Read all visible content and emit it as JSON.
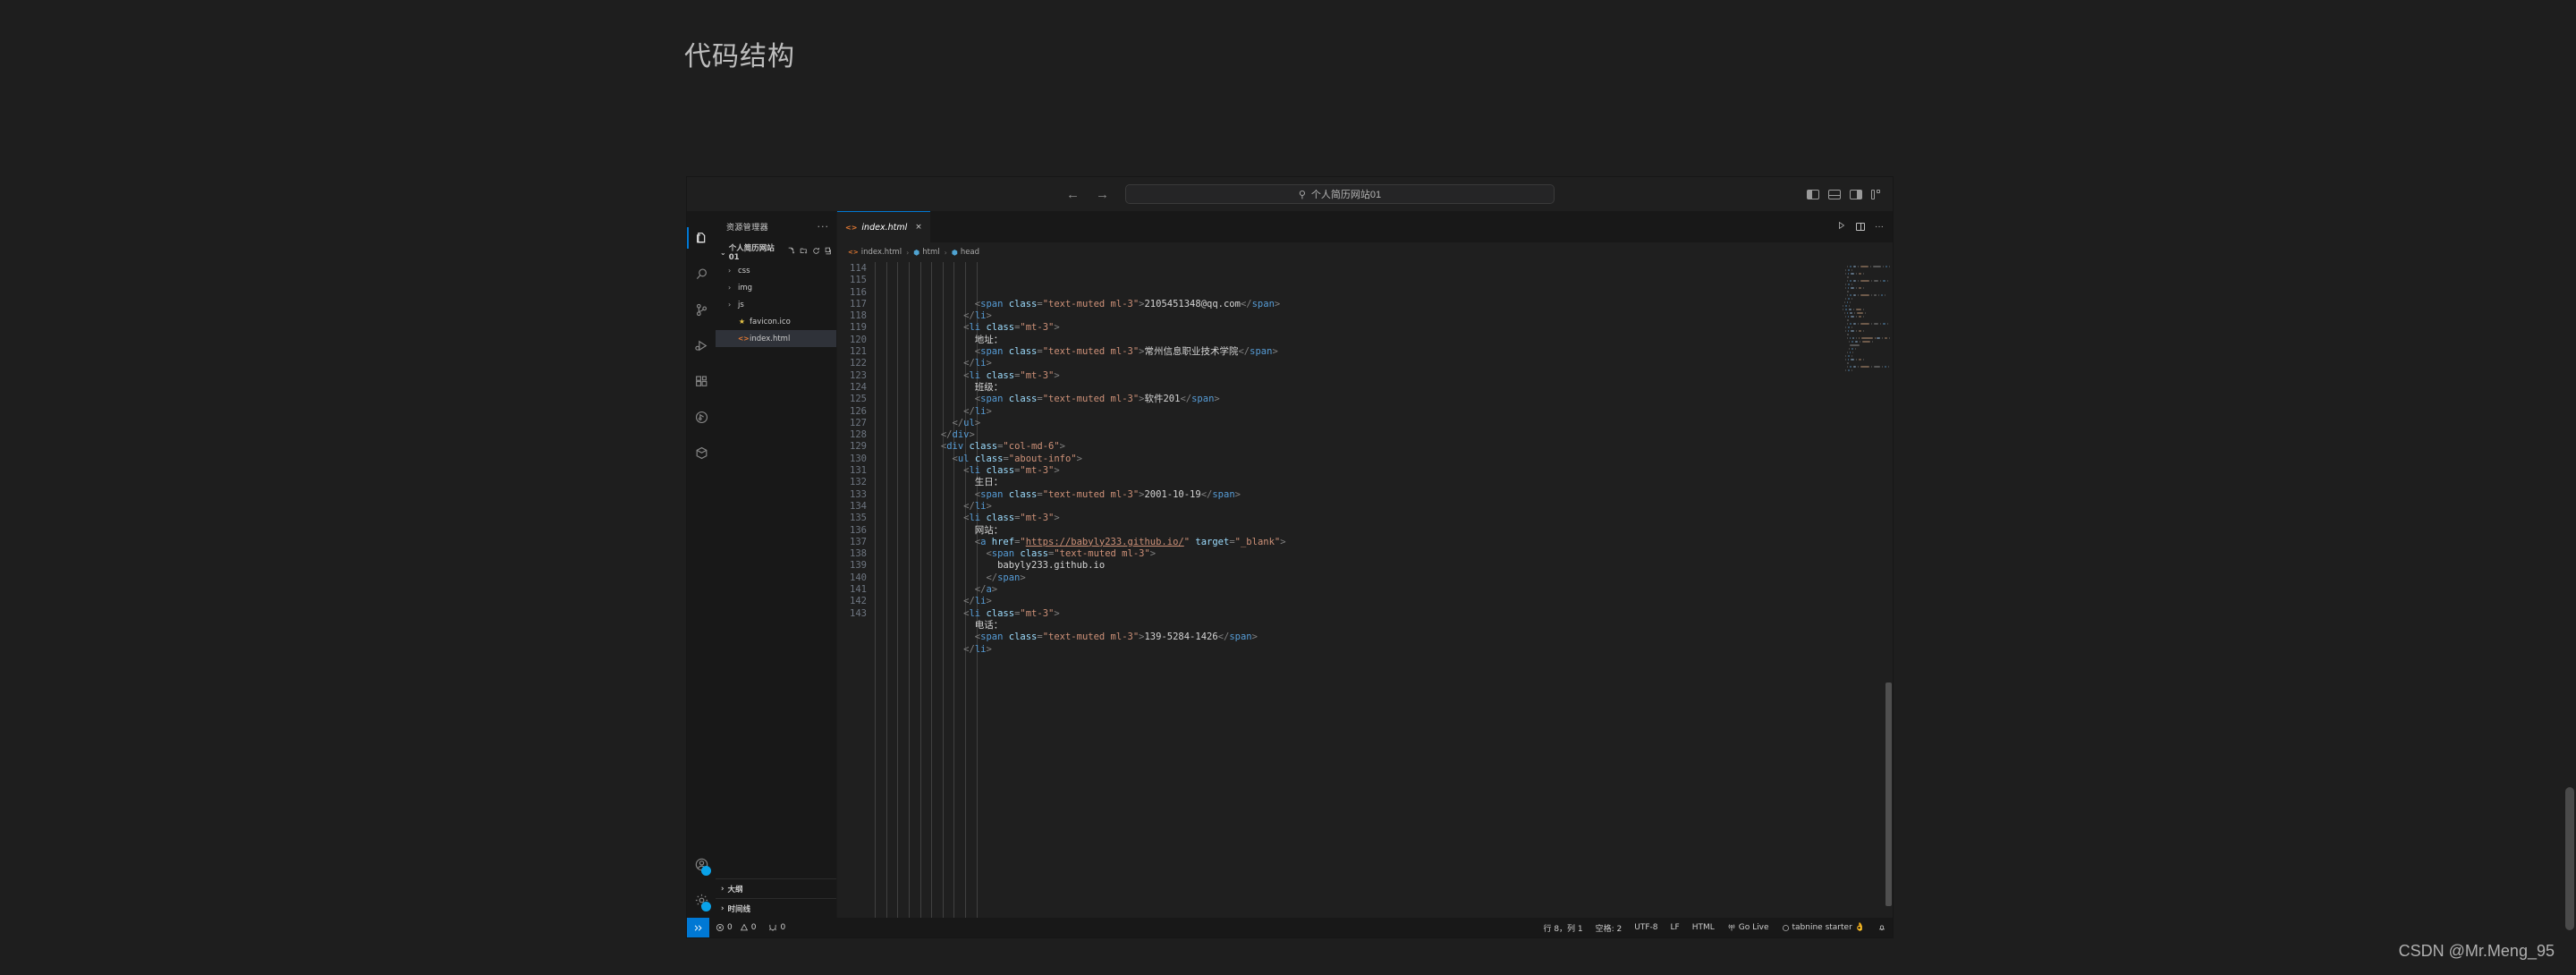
{
  "page": {
    "title": "代码结构",
    "watermark": "CSDN @Mr.Meng_95",
    "background_color": "#1e1e1e"
  },
  "titlebar": {
    "back_icon": "←",
    "forward_icon": "→",
    "search_icon": "search-icon",
    "search_value": "个人简历网站01",
    "layout_buttons": [
      "toggle-primary-sidebar",
      "toggle-panel",
      "toggle-secondary-sidebar",
      "customize-layout"
    ]
  },
  "activitybar": {
    "items": [
      {
        "name": "explorer",
        "glyph": "files-icon",
        "active": true
      },
      {
        "name": "search",
        "glyph": "search-icon",
        "active": false
      },
      {
        "name": "source-control",
        "glyph": "source-control-icon",
        "active": false
      },
      {
        "name": "run-and-debug",
        "glyph": "debug-icon",
        "active": false
      },
      {
        "name": "extensions",
        "glyph": "extensions-icon",
        "active": false
      },
      {
        "name": "testing",
        "glyph": "beaker-icon",
        "active": false
      },
      {
        "name": "remote",
        "glyph": "cube-icon",
        "active": false
      }
    ],
    "bottom_items": [
      {
        "name": "accounts",
        "glyph": "account-icon"
      },
      {
        "name": "settings",
        "glyph": "gear-icon"
      }
    ]
  },
  "sidebar": {
    "header": "资源管理器",
    "more_actions": "···",
    "root": {
      "label": "个人简历网站01",
      "chevron": "⌄",
      "actions": [
        "new-file",
        "new-folder",
        "refresh",
        "collapse-all"
      ]
    },
    "tree": [
      {
        "label": "css",
        "type": "folder",
        "chevron": "›",
        "icon": "folder-icon",
        "selected": false
      },
      {
        "label": "img",
        "type": "folder",
        "chevron": "›",
        "icon": "folder-icon",
        "selected": false
      },
      {
        "label": "js",
        "type": "folder",
        "chevron": "›",
        "icon": "folder-icon",
        "selected": false
      },
      {
        "label": "favicon.ico",
        "type": "file",
        "chevron": "",
        "icon": "star-icon",
        "selected": false
      },
      {
        "label": "index.html",
        "type": "file",
        "chevron": "",
        "icon": "html-file-icon",
        "selected": true
      }
    ],
    "sections": [
      {
        "label": "大纲",
        "chevron": "›"
      },
      {
        "label": "时间线",
        "chevron": "›"
      }
    ]
  },
  "editor": {
    "tab": {
      "label": "index.html",
      "icon": "html-file-icon",
      "close_icon": "×"
    },
    "tab_actions": [
      "run-icon",
      "split-editor-icon",
      "more-actions-icon"
    ],
    "breadcrumbs": [
      {
        "label": "index.html",
        "icon": "html-file-icon"
      },
      {
        "label": "html",
        "icon": "symbol-cube-icon"
      },
      {
        "label": "head",
        "icon": "symbol-cube-icon"
      }
    ],
    "first_line_number": 114,
    "lines": [
      {
        "n": 114,
        "indent": 5,
        "tokens": [
          {
            "t": "brk",
            "v": "<"
          },
          {
            "t": "tag",
            "v": "span"
          },
          {
            "t": "attr",
            "v": " class"
          },
          {
            "t": "brk",
            "v": "="
          },
          {
            "t": "str",
            "v": "\"text-muted ml-3\""
          },
          {
            "t": "brk",
            "v": ">"
          },
          {
            "t": "txt",
            "v": "2105451348@qq.com"
          },
          {
            "t": "brk",
            "v": "</"
          },
          {
            "t": "tag",
            "v": "span"
          },
          {
            "t": "brk",
            "v": ">"
          }
        ]
      },
      {
        "n": 115,
        "indent": 4,
        "tokens": [
          {
            "t": "brk",
            "v": "</"
          },
          {
            "t": "tag",
            "v": "li"
          },
          {
            "t": "brk",
            "v": ">"
          }
        ]
      },
      {
        "n": 116,
        "indent": 4,
        "tokens": [
          {
            "t": "brk",
            "v": "<"
          },
          {
            "t": "tag",
            "v": "li"
          },
          {
            "t": "attr",
            "v": " class"
          },
          {
            "t": "brk",
            "v": "="
          },
          {
            "t": "str",
            "v": "\"mt-3\""
          },
          {
            "t": "brk",
            "v": ">"
          }
        ]
      },
      {
        "n": 117,
        "indent": 5,
        "tokens": [
          {
            "t": "txt",
            "v": "地址："
          }
        ]
      },
      {
        "n": 118,
        "indent": 5,
        "tokens": [
          {
            "t": "brk",
            "v": "<"
          },
          {
            "t": "tag",
            "v": "span"
          },
          {
            "t": "attr",
            "v": " class"
          },
          {
            "t": "brk",
            "v": "="
          },
          {
            "t": "str",
            "v": "\"text-muted ml-3\""
          },
          {
            "t": "brk",
            "v": ">"
          },
          {
            "t": "txt",
            "v": "常州信息职业技术学院"
          },
          {
            "t": "brk",
            "v": "</"
          },
          {
            "t": "tag",
            "v": "span"
          },
          {
            "t": "brk",
            "v": ">"
          }
        ]
      },
      {
        "n": 119,
        "indent": 4,
        "tokens": [
          {
            "t": "brk",
            "v": "</"
          },
          {
            "t": "tag",
            "v": "li"
          },
          {
            "t": "brk",
            "v": ">"
          }
        ]
      },
      {
        "n": 120,
        "indent": 4,
        "tokens": [
          {
            "t": "brk",
            "v": "<"
          },
          {
            "t": "tag",
            "v": "li"
          },
          {
            "t": "attr",
            "v": " class"
          },
          {
            "t": "brk",
            "v": "="
          },
          {
            "t": "str",
            "v": "\"mt-3\""
          },
          {
            "t": "brk",
            "v": ">"
          }
        ]
      },
      {
        "n": 121,
        "indent": 5,
        "tokens": [
          {
            "t": "txt",
            "v": "班级："
          }
        ]
      },
      {
        "n": 122,
        "indent": 5,
        "tokens": [
          {
            "t": "brk",
            "v": "<"
          },
          {
            "t": "tag",
            "v": "span"
          },
          {
            "t": "attr",
            "v": " class"
          },
          {
            "t": "brk",
            "v": "="
          },
          {
            "t": "str",
            "v": "\"text-muted ml-3\""
          },
          {
            "t": "brk",
            "v": ">"
          },
          {
            "t": "txt",
            "v": "软件201"
          },
          {
            "t": "brk",
            "v": "</"
          },
          {
            "t": "tag",
            "v": "span"
          },
          {
            "t": "brk",
            "v": ">"
          }
        ]
      },
      {
        "n": 123,
        "indent": 4,
        "tokens": [
          {
            "t": "brk",
            "v": "</"
          },
          {
            "t": "tag",
            "v": "li"
          },
          {
            "t": "brk",
            "v": ">"
          }
        ]
      },
      {
        "n": 124,
        "indent": 3,
        "tokens": [
          {
            "t": "brk",
            "v": "</"
          },
          {
            "t": "tag",
            "v": "ul"
          },
          {
            "t": "brk",
            "v": ">"
          }
        ]
      },
      {
        "n": 125,
        "indent": 2,
        "tokens": [
          {
            "t": "brk",
            "v": "</"
          },
          {
            "t": "tag",
            "v": "div"
          },
          {
            "t": "brk",
            "v": ">"
          }
        ]
      },
      {
        "n": 126,
        "indent": 2,
        "tokens": [
          {
            "t": "brk",
            "v": "<"
          },
          {
            "t": "tag",
            "v": "div"
          },
          {
            "t": "attr",
            "v": " class"
          },
          {
            "t": "brk",
            "v": "="
          },
          {
            "t": "str",
            "v": "\"col-md-6\""
          },
          {
            "t": "brk",
            "v": ">"
          }
        ]
      },
      {
        "n": 127,
        "indent": 3,
        "tokens": [
          {
            "t": "brk",
            "v": "<"
          },
          {
            "t": "tag",
            "v": "ul"
          },
          {
            "t": "attr",
            "v": " class"
          },
          {
            "t": "brk",
            "v": "="
          },
          {
            "t": "str",
            "v": "\"about-info\""
          },
          {
            "t": "brk",
            "v": ">"
          }
        ]
      },
      {
        "n": 128,
        "indent": 4,
        "tokens": [
          {
            "t": "brk",
            "v": "<"
          },
          {
            "t": "tag",
            "v": "li"
          },
          {
            "t": "attr",
            "v": " class"
          },
          {
            "t": "brk",
            "v": "="
          },
          {
            "t": "str",
            "v": "\"mt-3\""
          },
          {
            "t": "brk",
            "v": ">"
          }
        ]
      },
      {
        "n": 129,
        "indent": 5,
        "tokens": [
          {
            "t": "txt",
            "v": "生日："
          }
        ]
      },
      {
        "n": 130,
        "indent": 5,
        "tokens": [
          {
            "t": "brk",
            "v": "<"
          },
          {
            "t": "tag",
            "v": "span"
          },
          {
            "t": "attr",
            "v": " class"
          },
          {
            "t": "brk",
            "v": "="
          },
          {
            "t": "str",
            "v": "\"text-muted ml-3\""
          },
          {
            "t": "brk",
            "v": ">"
          },
          {
            "t": "txt",
            "v": "2001-10-19"
          },
          {
            "t": "brk",
            "v": "</"
          },
          {
            "t": "tag",
            "v": "span"
          },
          {
            "t": "brk",
            "v": ">"
          }
        ]
      },
      {
        "n": 131,
        "indent": 4,
        "tokens": [
          {
            "t": "brk",
            "v": "</"
          },
          {
            "t": "tag",
            "v": "li"
          },
          {
            "t": "brk",
            "v": ">"
          }
        ]
      },
      {
        "n": 132,
        "indent": 4,
        "tokens": [
          {
            "t": "brk",
            "v": "<"
          },
          {
            "t": "tag",
            "v": "li"
          },
          {
            "t": "attr",
            "v": " class"
          },
          {
            "t": "brk",
            "v": "="
          },
          {
            "t": "str",
            "v": "\"mt-3\""
          },
          {
            "t": "brk",
            "v": ">"
          }
        ]
      },
      {
        "n": 133,
        "indent": 5,
        "tokens": [
          {
            "t": "txt",
            "v": "网站："
          }
        ]
      },
      {
        "n": 134,
        "indent": 5,
        "tokens": [
          {
            "t": "brk",
            "v": "<"
          },
          {
            "t": "tag",
            "v": "a"
          },
          {
            "t": "attr",
            "v": " href"
          },
          {
            "t": "brk",
            "v": "="
          },
          {
            "t": "str",
            "v": "\""
          },
          {
            "t": "link",
            "v": "https://babyly233.github.io/"
          },
          {
            "t": "str",
            "v": "\""
          },
          {
            "t": "attr",
            "v": " target"
          },
          {
            "t": "brk",
            "v": "="
          },
          {
            "t": "str",
            "v": "\"_blank\""
          },
          {
            "t": "brk",
            "v": ">"
          }
        ]
      },
      {
        "n": 135,
        "indent": 6,
        "tokens": [
          {
            "t": "brk",
            "v": "<"
          },
          {
            "t": "tag",
            "v": "span"
          },
          {
            "t": "attr",
            "v": " class"
          },
          {
            "t": "brk",
            "v": "="
          },
          {
            "t": "str",
            "v": "\"text-muted ml-3\""
          },
          {
            "t": "brk",
            "v": ">"
          }
        ]
      },
      {
        "n": 136,
        "indent": 7,
        "tokens": [
          {
            "t": "txt",
            "v": "babyly233.github.io"
          }
        ]
      },
      {
        "n": 137,
        "indent": 6,
        "tokens": [
          {
            "t": "brk",
            "v": "</"
          },
          {
            "t": "tag",
            "v": "span"
          },
          {
            "t": "brk",
            "v": ">"
          }
        ]
      },
      {
        "n": 138,
        "indent": 5,
        "tokens": [
          {
            "t": "brk",
            "v": "</"
          },
          {
            "t": "tag",
            "v": "a"
          },
          {
            "t": "brk",
            "v": ">"
          }
        ]
      },
      {
        "n": 139,
        "indent": 4,
        "tokens": [
          {
            "t": "brk",
            "v": "</"
          },
          {
            "t": "tag",
            "v": "li"
          },
          {
            "t": "brk",
            "v": ">"
          }
        ]
      },
      {
        "n": 140,
        "indent": 4,
        "tokens": [
          {
            "t": "brk",
            "v": "<"
          },
          {
            "t": "tag",
            "v": "li"
          },
          {
            "t": "attr",
            "v": " class"
          },
          {
            "t": "brk",
            "v": "="
          },
          {
            "t": "str",
            "v": "\"mt-3\""
          },
          {
            "t": "brk",
            "v": ">"
          }
        ]
      },
      {
        "n": 141,
        "indent": 5,
        "tokens": [
          {
            "t": "txt",
            "v": "电话："
          }
        ]
      },
      {
        "n": 142,
        "indent": 5,
        "tokens": [
          {
            "t": "brk",
            "v": "<"
          },
          {
            "t": "tag",
            "v": "span"
          },
          {
            "t": "attr",
            "v": " class"
          },
          {
            "t": "brk",
            "v": "="
          },
          {
            "t": "str",
            "v": "\"text-muted ml-3\""
          },
          {
            "t": "brk",
            "v": ">"
          },
          {
            "t": "txt",
            "v": "139-5284-1426"
          },
          {
            "t": "brk",
            "v": "</"
          },
          {
            "t": "tag",
            "v": "span"
          },
          {
            "t": "brk",
            "v": ">"
          }
        ]
      },
      {
        "n": 143,
        "indent": 4,
        "tokens": [
          {
            "t": "brk",
            "v": "</"
          },
          {
            "t": "tag",
            "v": "li"
          },
          {
            "t": "brk",
            "v": ">"
          }
        ]
      }
    ]
  },
  "statusbar": {
    "remote_icon": "remote-window-icon",
    "errors_icon": "error-icon",
    "errors": "0",
    "warnings_icon": "warning-icon",
    "warnings": "0",
    "ports_icon": "ports-icon",
    "ports": "0",
    "cursor_position": "行 8，列 1",
    "indentation": "空格: 2",
    "encoding": "UTF-8",
    "eol": "LF",
    "language": "HTML",
    "golive_icon": "broadcast-icon",
    "golive": "Go Live",
    "tabnine_icon": "tabnine-icon",
    "tabnine": "tabnine starter",
    "emoji": "👌",
    "bell_icon": "bell-icon"
  },
  "colors": {
    "accent": "#0078d4",
    "tag": "#569cd6",
    "attr": "#9cdcfe",
    "string": "#ce9178",
    "text": "#d4d4d4",
    "bracket": "#808080",
    "editor_bg": "#1f1f1f",
    "sidebar_bg": "#181818"
  }
}
